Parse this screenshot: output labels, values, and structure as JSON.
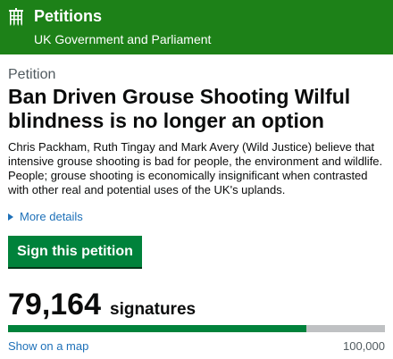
{
  "header": {
    "title": "Petitions",
    "subtitle": "UK Government and Parliament",
    "background": "#1d8118",
    "logo_icon": "portcullis-icon"
  },
  "petition": {
    "eyebrow": "Petition",
    "title": "Ban Driven Grouse Shooting Wilful blindness is no longer an option",
    "summary": "Chris Packham, Ruth Tingay and Mark Avery (Wild Justice) believe that intensive grouse shooting is bad for people, the environment and wildlife. People; grouse shooting is economically insignificant when contrasted with other real and potential uses of the UK's uplands.",
    "more_details": "More details",
    "more_details_icon": "triangle-right-icon",
    "sign_label": "Sign this petition",
    "button_color": "#00823b"
  },
  "signatures": {
    "count": "79,164",
    "label": "signatures",
    "progress": 0.79164,
    "map_link": "Show on a map",
    "target": "100,000"
  }
}
